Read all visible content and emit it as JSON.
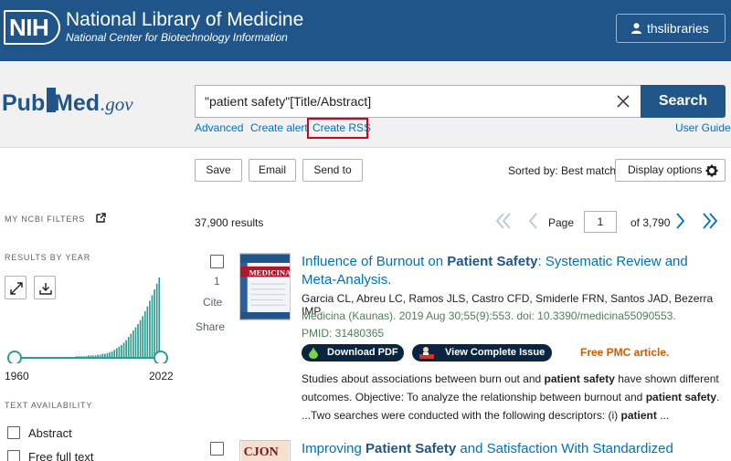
{
  "nih": {
    "logo_text": "NIH",
    "title": "National Library of Medicine",
    "subtitle": "National Center for Biotechnology Information",
    "user": "thslibraries"
  },
  "pubmed": {
    "logo_part1": "Pub",
    "logo_part2": "Med",
    "logo_part3": ".gov"
  },
  "search": {
    "query": "\"patient safety\"[Title/Abstract]",
    "button": "Search",
    "links": [
      "Advanced",
      "Create alert",
      "Create RSS"
    ],
    "user_guide": "User Guide"
  },
  "toolbar": {
    "save": "Save",
    "email": "Email",
    "send_to": "Send to",
    "sorted_by": "Sorted by: Best match",
    "display_options": "Display options"
  },
  "sidebar": {
    "my_filters": "MY NCBI FILTERS",
    "results_by_year": "RESULTS BY YEAR",
    "year_start": "1960",
    "year_end": "2022",
    "text_availability": "TEXT AVAILABILITY",
    "filters": [
      "Abstract",
      "Free full text"
    ]
  },
  "results": {
    "count": "37,900 results",
    "page_label": "Page",
    "page_value": "1",
    "page_total": "of 3,790",
    "items": [
      {
        "number": "1",
        "cite": "Cite",
        "share": "Share",
        "thumb_text": "MEDICINA",
        "title_pre": "Influence of Burnout on ",
        "title_bold": "Patient Safety",
        "title_post": ": Systematic Review and Meta-Analysis.",
        "authors": "Garcia CL, Abreu LC, Ramos JLS, Castro CFD, Smiderle FRN, Santos JAD, Bezerra IMP.",
        "journal": "Medicina (Kaunas). 2019 Aug 30;55(9):553. doi: 10.3390/medicina55090553.",
        "pmid": "PMID: 31480365",
        "download_pdf": "Download PDF",
        "view_issue": "View Complete Issue",
        "free_pmc": "Free PMC article.",
        "snippet_1": "Studies about associations between burn out and ",
        "snippet_1_bold": "patient safety",
        "snippet_1_post": " have shown different outcomes. Objective: To analyze the relationship between burnout and ",
        "snippet_2_bold": "patient safety",
        "snippet_2_post": ". ...Two searches were conducted with the following descriptors: (i) ",
        "snippet_3_bold": "patient",
        "snippet_3_post": " ..."
      },
      {
        "thumb_text": "CJON",
        "title_pre": "Improving ",
        "title_bold": "Patient Safety",
        "title_post": " and Satisfaction With Standardized Bedside"
      }
    ]
  },
  "colors": {
    "nih_blue": "#20558a",
    "link_blue": "#0071bc",
    "chart_teal": "#2e9b8f",
    "rss_highlight": "#d0021b",
    "journal_green": "#4d8055",
    "free_orange": "#cd5c00"
  },
  "year_histogram": [
    1,
    1,
    1,
    1,
    1,
    1,
    1,
    1,
    1,
    1,
    1,
    1,
    1,
    1,
    1,
    1,
    1,
    1,
    1,
    1,
    1,
    1,
    1,
    1,
    1,
    1,
    2,
    2,
    2,
    2,
    2,
    3,
    3,
    3,
    3,
    4,
    4,
    5,
    5,
    6,
    7,
    8,
    10,
    12,
    14,
    16,
    19,
    22,
    26,
    30,
    34,
    38,
    42,
    47,
    52,
    58,
    64,
    71,
    78,
    85,
    92,
    100
  ]
}
